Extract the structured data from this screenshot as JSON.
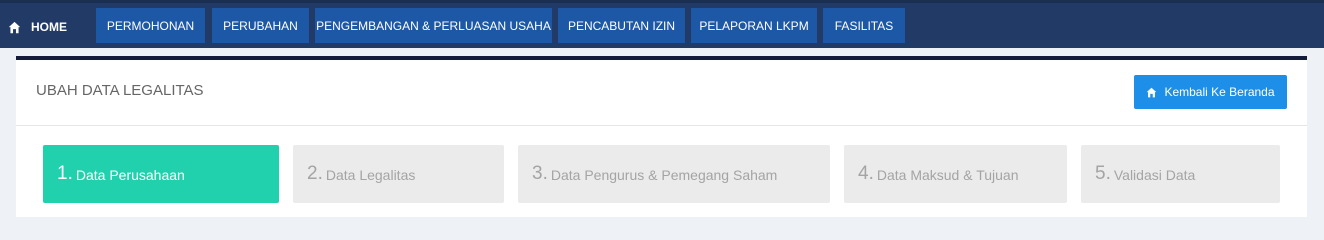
{
  "nav": {
    "home_label": "HOME",
    "items": [
      {
        "label": "PERMOHONAN"
      },
      {
        "label": "PERUBAHAN"
      },
      {
        "label": "PENGEMBANGAN & PERLUASAN USAHA"
      },
      {
        "label": "PENCABUTAN IZIN"
      },
      {
        "label": "PELAPORAN LKPM"
      },
      {
        "label": "FASILITAS"
      }
    ]
  },
  "panel": {
    "title": "UBAH DATA LEGALITAS",
    "back_button_label": "Kembali Ke Beranda"
  },
  "steps": [
    {
      "number": "1.",
      "label": "Data Perusahaan",
      "active": true
    },
    {
      "number": "2.",
      "label": "Data Legalitas",
      "active": false
    },
    {
      "number": "3.",
      "label": "Data Pengurus & Pemegang Saham",
      "active": false
    },
    {
      "number": "4.",
      "label": "Data Maksud & Tujuan",
      "active": false
    },
    {
      "number": "5.",
      "label": "Validasi Data",
      "active": false
    }
  ],
  "colors": {
    "nav_bar": "#223b66",
    "nav_button": "#1d58a6",
    "active_step": "#21d1ad",
    "inactive_step": "#ebebeb",
    "back_button": "#1e8fe8"
  }
}
